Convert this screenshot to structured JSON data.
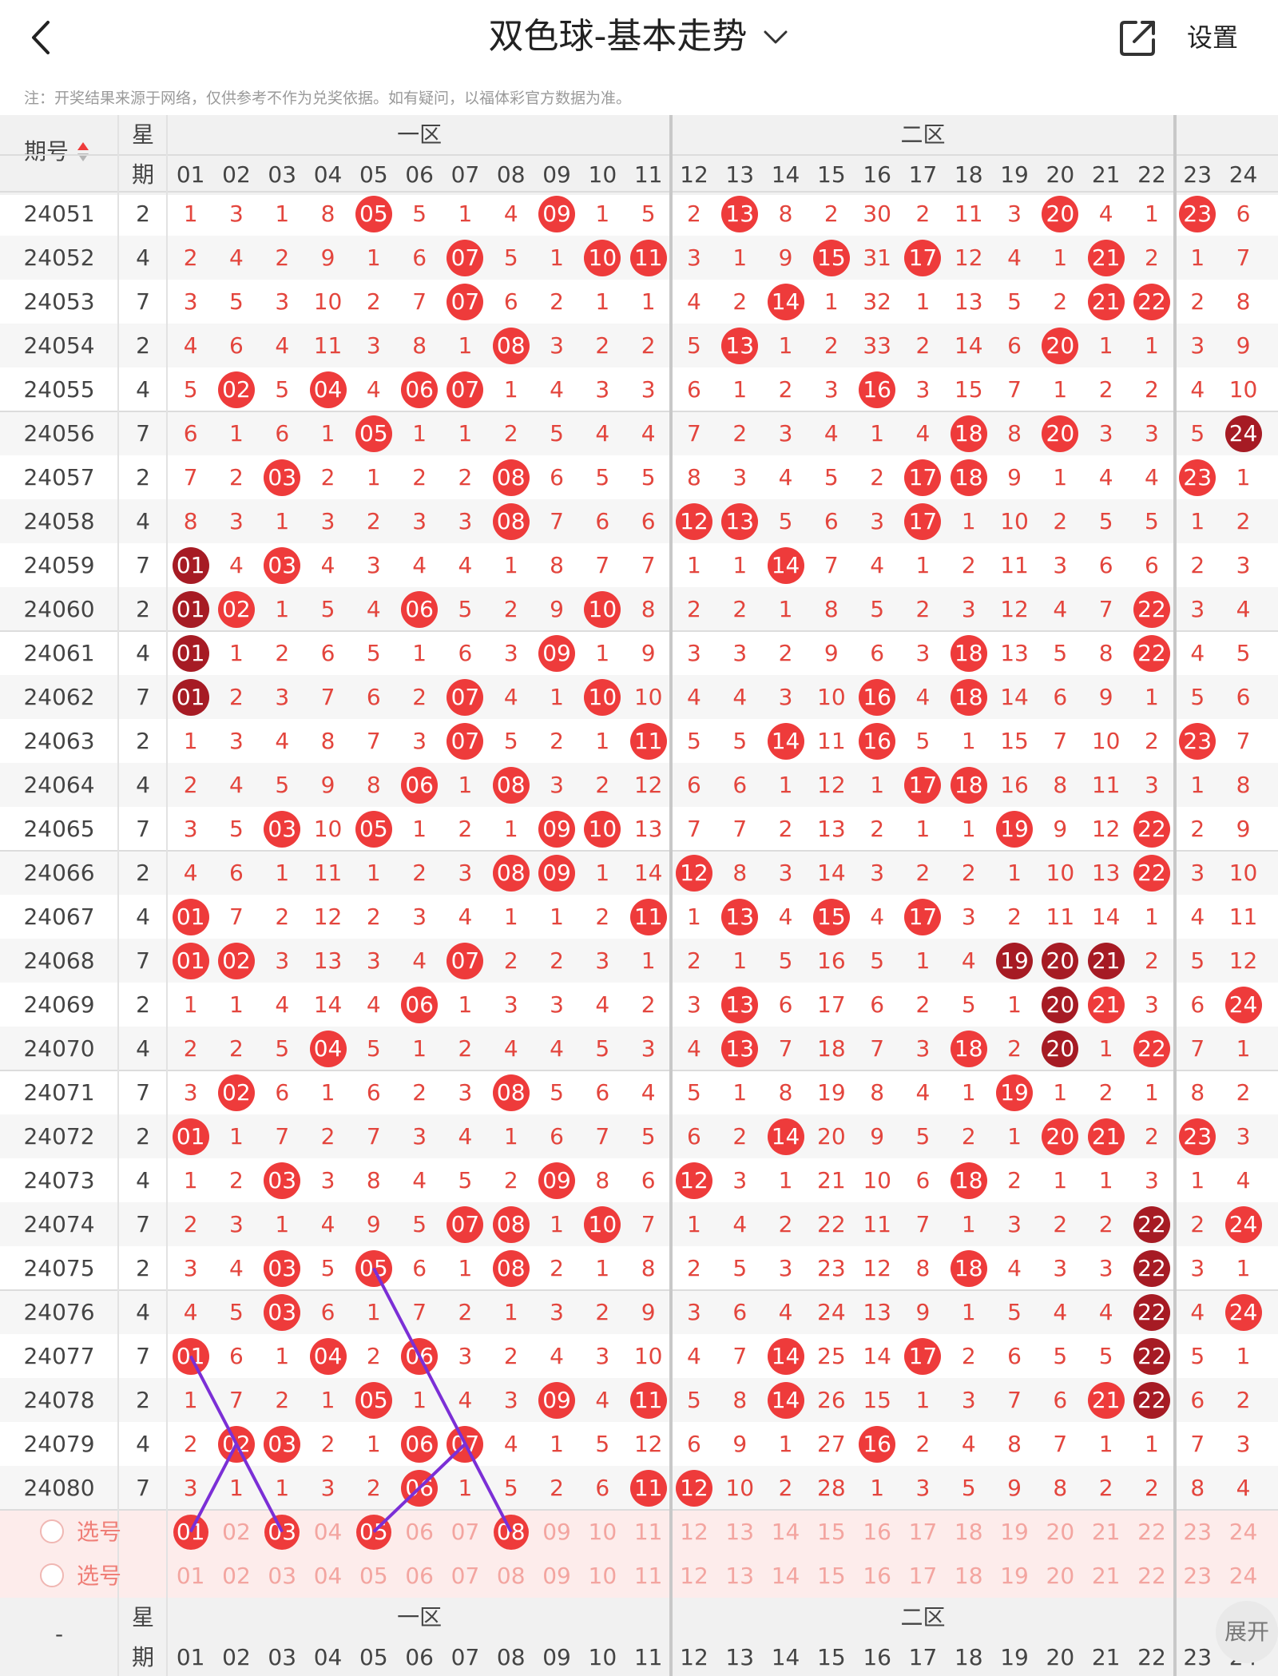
{
  "header": {
    "title": "双色球-基本走势",
    "settings_label": "设置",
    "notice": "注：开奖结果来源于网络，仅供参考不作为兑奖依据。如有疑问，以福体彩官方数据为准。"
  },
  "table_header": {
    "issue_label": "期号",
    "weekday_top": "星",
    "weekday_bottom": "期",
    "zone1": "一区",
    "zone2": "二区",
    "numbers": [
      "01",
      "02",
      "03",
      "04",
      "05",
      "06",
      "07",
      "08",
      "09",
      "10",
      "11",
      "12",
      "13",
      "14",
      "15",
      "16",
      "17",
      "18",
      "19",
      "20",
      "21",
      "22",
      "23",
      "24"
    ]
  },
  "rows": [
    {
      "issue": "24051",
      "wd": "2",
      "v": [
        "1",
        "3",
        "1",
        "8",
        "05",
        "5",
        "1",
        "4",
        "09",
        "1",
        "5",
        "2",
        "13",
        "8",
        "2",
        "30",
        "2",
        "11",
        "3",
        "20",
        "4",
        "1",
        "23",
        "6"
      ]
    },
    {
      "issue": "24052",
      "wd": "4",
      "v": [
        "2",
        "4",
        "2",
        "9",
        "1",
        "6",
        "07",
        "5",
        "1",
        "10",
        "11",
        "3",
        "1",
        "9",
        "15",
        "31",
        "17",
        "12",
        "4",
        "1",
        "21",
        "2",
        "1",
        "7"
      ]
    },
    {
      "issue": "24053",
      "wd": "7",
      "v": [
        "3",
        "5",
        "3",
        "10",
        "2",
        "7",
        "07",
        "6",
        "2",
        "1",
        "1",
        "4",
        "2",
        "14",
        "1",
        "32",
        "1",
        "13",
        "5",
        "2",
        "21",
        "22",
        "2",
        "8"
      ]
    },
    {
      "issue": "24054",
      "wd": "2",
      "v": [
        "4",
        "6",
        "4",
        "11",
        "3",
        "8",
        "1",
        "08",
        "3",
        "2",
        "2",
        "5",
        "13",
        "1",
        "2",
        "33",
        "2",
        "14",
        "6",
        "20",
        "1",
        "1",
        "3",
        "9"
      ]
    },
    {
      "issue": "24055",
      "wd": "4",
      "v": [
        "5",
        "02",
        "5",
        "04",
        "4",
        "06",
        "07",
        "1",
        "4",
        "3",
        "3",
        "6",
        "1",
        "2",
        "3",
        "16",
        "3",
        "15",
        "7",
        "1",
        "2",
        "2",
        "4",
        "10"
      ]
    },
    {
      "issue": "24056",
      "wd": "7",
      "v": [
        "6",
        "1",
        "6",
        "1",
        "05",
        "1",
        "1",
        "2",
        "5",
        "4",
        "4",
        "7",
        "2",
        "3",
        "4",
        "1",
        "4",
        "18",
        "8",
        "20",
        "3",
        "3",
        "5",
        "24"
      ]
    },
    {
      "issue": "24057",
      "wd": "2",
      "v": [
        "7",
        "2",
        "03",
        "2",
        "1",
        "2",
        "2",
        "08",
        "6",
        "5",
        "5",
        "8",
        "3",
        "4",
        "5",
        "2",
        "17",
        "18",
        "9",
        "1",
        "4",
        "4",
        "23",
        "1"
      ]
    },
    {
      "issue": "24058",
      "wd": "4",
      "v": [
        "8",
        "3",
        "1",
        "3",
        "2",
        "3",
        "3",
        "08",
        "7",
        "6",
        "6",
        "12",
        "13",
        "5",
        "6",
        "3",
        "17",
        "1",
        "10",
        "2",
        "5",
        "5",
        "1",
        "2"
      ]
    },
    {
      "issue": "24059",
      "wd": "7",
      "v": [
        "01",
        "4",
        "03",
        "4",
        "3",
        "4",
        "4",
        "1",
        "8",
        "7",
        "7",
        "1",
        "1",
        "14",
        "7",
        "4",
        "1",
        "2",
        "11",
        "3",
        "6",
        "6",
        "2",
        "3"
      ]
    },
    {
      "issue": "24060",
      "wd": "2",
      "v": [
        "01",
        "02",
        "1",
        "5",
        "4",
        "06",
        "5",
        "2",
        "9",
        "10",
        "8",
        "2",
        "2",
        "1",
        "8",
        "5",
        "2",
        "3",
        "12",
        "4",
        "7",
        "22",
        "3",
        "4"
      ]
    },
    {
      "issue": "24061",
      "wd": "4",
      "v": [
        "01",
        "1",
        "2",
        "6",
        "5",
        "1",
        "6",
        "3",
        "09",
        "1",
        "9",
        "3",
        "3",
        "2",
        "9",
        "6",
        "3",
        "18",
        "13",
        "5",
        "8",
        "22",
        "4",
        "5"
      ]
    },
    {
      "issue": "24062",
      "wd": "7",
      "v": [
        "01",
        "2",
        "3",
        "7",
        "6",
        "2",
        "07",
        "4",
        "1",
        "10",
        "10",
        "4",
        "4",
        "3",
        "10",
        "16",
        "4",
        "18",
        "14",
        "6",
        "9",
        "1",
        "5",
        "6"
      ]
    },
    {
      "issue": "24063",
      "wd": "2",
      "v": [
        "1",
        "3",
        "4",
        "8",
        "7",
        "3",
        "07",
        "5",
        "2",
        "1",
        "11",
        "5",
        "5",
        "14",
        "11",
        "16",
        "5",
        "1",
        "15",
        "7",
        "10",
        "2",
        "23",
        "7"
      ]
    },
    {
      "issue": "24064",
      "wd": "4",
      "v": [
        "2",
        "4",
        "5",
        "9",
        "8",
        "06",
        "1",
        "08",
        "3",
        "2",
        "12",
        "6",
        "6",
        "1",
        "12",
        "1",
        "17",
        "18",
        "16",
        "8",
        "11",
        "3",
        "1",
        "8"
      ]
    },
    {
      "issue": "24065",
      "wd": "7",
      "v": [
        "3",
        "5",
        "03",
        "10",
        "05",
        "1",
        "2",
        "1",
        "09",
        "10",
        "13",
        "7",
        "7",
        "2",
        "13",
        "2",
        "1",
        "1",
        "19",
        "9",
        "12",
        "22",
        "2",
        "9"
      ]
    },
    {
      "issue": "24066",
      "wd": "2",
      "v": [
        "4",
        "6",
        "1",
        "11",
        "1",
        "2",
        "3",
        "08",
        "09",
        "1",
        "14",
        "12",
        "8",
        "3",
        "14",
        "3",
        "2",
        "2",
        "1",
        "10",
        "13",
        "22",
        "3",
        "10"
      ]
    },
    {
      "issue": "24067",
      "wd": "4",
      "v": [
        "01",
        "7",
        "2",
        "12",
        "2",
        "3",
        "4",
        "1",
        "1",
        "2",
        "11",
        "1",
        "13",
        "4",
        "15",
        "4",
        "17",
        "3",
        "2",
        "11",
        "14",
        "1",
        "4",
        "11"
      ]
    },
    {
      "issue": "24068",
      "wd": "7",
      "v": [
        "01",
        "02",
        "3",
        "13",
        "3",
        "4",
        "07",
        "2",
        "2",
        "3",
        "1",
        "2",
        "1",
        "5",
        "16",
        "5",
        "1",
        "4",
        "19",
        "20",
        "21",
        "2",
        "5",
        "12"
      ]
    },
    {
      "issue": "24069",
      "wd": "2",
      "v": [
        "1",
        "1",
        "4",
        "14",
        "4",
        "06",
        "1",
        "3",
        "3",
        "4",
        "2",
        "3",
        "13",
        "6",
        "17",
        "6",
        "2",
        "5",
        "1",
        "20",
        "21",
        "3",
        "6",
        "24"
      ]
    },
    {
      "issue": "24070",
      "wd": "4",
      "v": [
        "2",
        "2",
        "5",
        "04",
        "5",
        "1",
        "2",
        "4",
        "4",
        "5",
        "3",
        "4",
        "13",
        "7",
        "18",
        "7",
        "3",
        "18",
        "2",
        "20",
        "1",
        "22",
        "7",
        "1"
      ]
    },
    {
      "issue": "24071",
      "wd": "7",
      "v": [
        "3",
        "02",
        "6",
        "1",
        "6",
        "2",
        "3",
        "08",
        "5",
        "6",
        "4",
        "5",
        "1",
        "8",
        "19",
        "8",
        "4",
        "1",
        "19",
        "1",
        "2",
        "1",
        "8",
        "2"
      ]
    },
    {
      "issue": "24072",
      "wd": "2",
      "v": [
        "01",
        "1",
        "7",
        "2",
        "7",
        "3",
        "4",
        "1",
        "6",
        "7",
        "5",
        "6",
        "2",
        "14",
        "20",
        "9",
        "5",
        "2",
        "1",
        "20",
        "21",
        "2",
        "23",
        "3"
      ]
    },
    {
      "issue": "24073",
      "wd": "4",
      "v": [
        "1",
        "2",
        "03",
        "3",
        "8",
        "4",
        "5",
        "2",
        "09",
        "8",
        "6",
        "12",
        "3",
        "1",
        "21",
        "10",
        "6",
        "18",
        "2",
        "1",
        "1",
        "3",
        "1",
        "4"
      ]
    },
    {
      "issue": "24074",
      "wd": "7",
      "v": [
        "2",
        "3",
        "1",
        "4",
        "9",
        "5",
        "07",
        "08",
        "1",
        "10",
        "7",
        "1",
        "4",
        "2",
        "22",
        "11",
        "7",
        "1",
        "3",
        "2",
        "2",
        "22",
        "2",
        "24"
      ]
    },
    {
      "issue": "24075",
      "wd": "2",
      "v": [
        "3",
        "4",
        "03",
        "5",
        "05",
        "6",
        "1",
        "08",
        "2",
        "1",
        "8",
        "2",
        "5",
        "3",
        "23",
        "12",
        "8",
        "18",
        "4",
        "3",
        "3",
        "22",
        "3",
        "1"
      ]
    },
    {
      "issue": "24076",
      "wd": "4",
      "v": [
        "4",
        "5",
        "03",
        "6",
        "1",
        "7",
        "2",
        "1",
        "3",
        "2",
        "9",
        "3",
        "6",
        "4",
        "24",
        "13",
        "9",
        "1",
        "5",
        "4",
        "4",
        "22",
        "4",
        "24"
      ]
    },
    {
      "issue": "24077",
      "wd": "7",
      "v": [
        "01",
        "6",
        "1",
        "04",
        "2",
        "06",
        "3",
        "2",
        "4",
        "3",
        "10",
        "4",
        "7",
        "14",
        "25",
        "14",
        "17",
        "2",
        "6",
        "5",
        "5",
        "22",
        "5",
        "1"
      ]
    },
    {
      "issue": "24078",
      "wd": "2",
      "v": [
        "1",
        "7",
        "2",
        "1",
        "05",
        "1",
        "4",
        "3",
        "09",
        "4",
        "11",
        "5",
        "8",
        "14",
        "26",
        "15",
        "1",
        "3",
        "7",
        "6",
        "21",
        "22",
        "6",
        "2"
      ]
    },
    {
      "issue": "24079",
      "wd": "4",
      "v": [
        "2",
        "02",
        "03",
        "2",
        "1",
        "06",
        "07",
        "4",
        "1",
        "5",
        "12",
        "6",
        "9",
        "1",
        "27",
        "16",
        "2",
        "4",
        "8",
        "7",
        "1",
        "1",
        "7",
        "3"
      ]
    },
    {
      "issue": "24080",
      "wd": "7",
      "v": [
        "3",
        "1",
        "1",
        "3",
        "2",
        "06",
        "1",
        "5",
        "2",
        "6",
        "11",
        "12",
        "10",
        "2",
        "28",
        "1",
        "3",
        "5",
        "9",
        "8",
        "2",
        "2",
        "8",
        "4"
      ]
    }
  ],
  "dark_balls": [
    "24059-01",
    "24060-01",
    "24061-01",
    "24062-01",
    "24056-24",
    "24068-19",
    "24068-20",
    "24068-21",
    "24069-20",
    "24070-20",
    "24074-22",
    "24075-22",
    "24076-22",
    "24077-22",
    "24078-22"
  ],
  "pick_rows": [
    {
      "label": "选号",
      "selected": [
        "01",
        "03",
        "05",
        "08"
      ]
    },
    {
      "label": "选号",
      "selected": []
    }
  ],
  "footer": {
    "issue_label": "-",
    "expand_label": "展开"
  },
  "colors": {
    "ball_red": "#ee3b3b",
    "ball_dark": "#a61b24",
    "miss_text": "#e3453d",
    "line": "#7b2fd6"
  },
  "icons": [
    "back-arrow-icon",
    "chevron-down-icon",
    "share-icon",
    "sort-icon",
    "radio-icon"
  ]
}
